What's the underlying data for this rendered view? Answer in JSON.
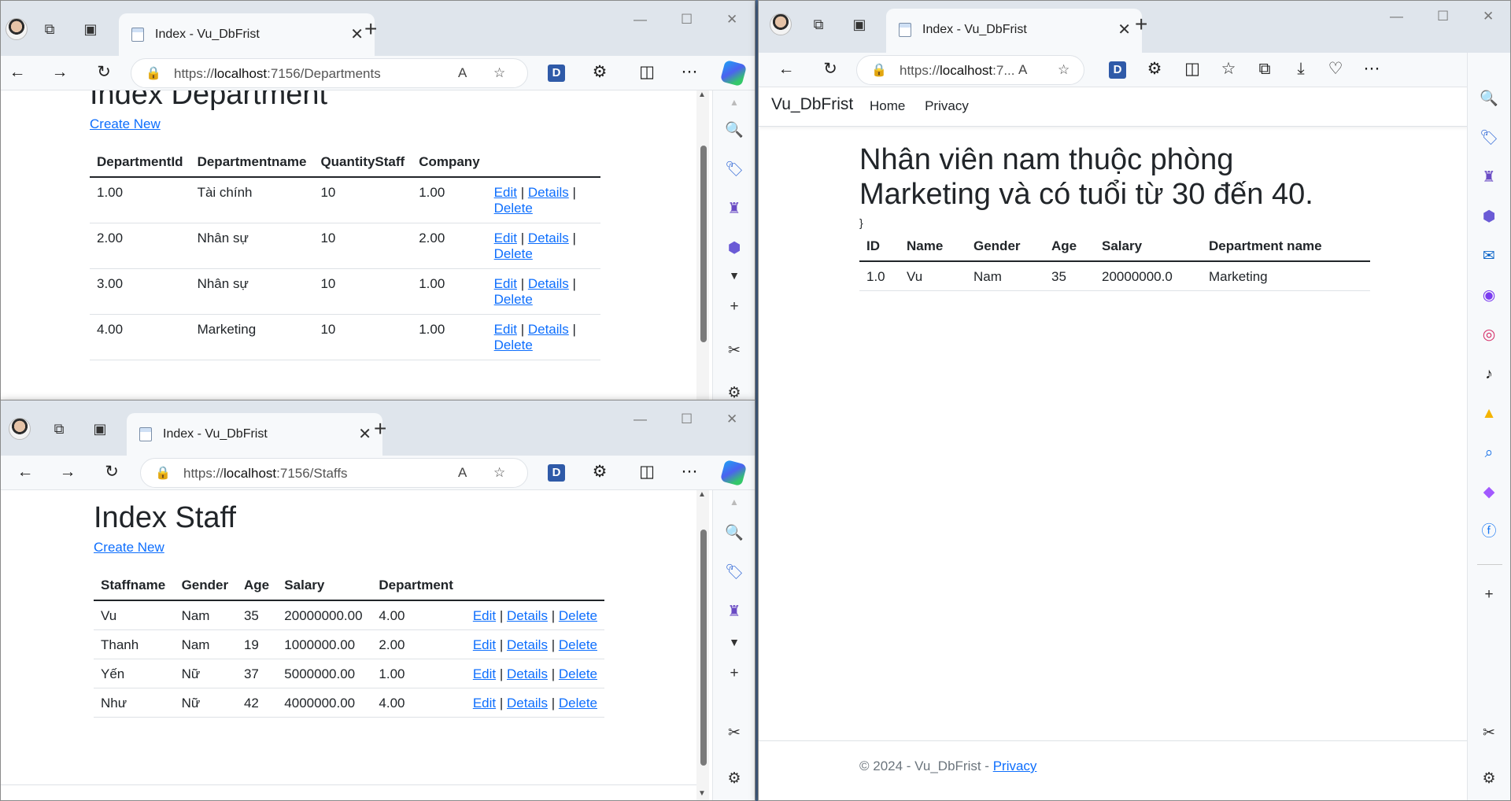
{
  "windows": {
    "departments": {
      "tab_title": "Index - Vu_DbFrist",
      "url_prefix": "https://",
      "url_host": "localhost",
      "url_rest": ":7156/Departments",
      "page": {
        "title": "Index Department",
        "create_new": "Create New",
        "columns": [
          "DepartmentId",
          "Departmentname",
          "QuantityStaff",
          "Company"
        ],
        "rows": [
          {
            "id": "1.00",
            "name": "Tài chính",
            "qty": "10",
            "company": "1.00"
          },
          {
            "id": "2.00",
            "name": "Nhân sự",
            "qty": "10",
            "company": "2.00"
          },
          {
            "id": "3.00",
            "name": "Nhân sự",
            "qty": "10",
            "company": "1.00"
          },
          {
            "id": "4.00",
            "name": "Marketing",
            "qty": "10",
            "company": "1.00"
          }
        ]
      }
    },
    "staffs": {
      "tab_title": "Index - Vu_DbFrist",
      "url_prefix": "https://",
      "url_host": "localhost",
      "url_rest": ":7156/Staffs",
      "page": {
        "title": "Index Staff",
        "create_new": "Create New",
        "columns": [
          "Staffname",
          "Gender",
          "Age",
          "Salary",
          "Department"
        ],
        "rows": [
          {
            "name": "Vu",
            "gender": "Nam",
            "age": "35",
            "salary": "20000000.00",
            "dept": "4.00"
          },
          {
            "name": "Thanh",
            "gender": "Nam",
            "age": "19",
            "salary": "1000000.00",
            "dept": "2.00"
          },
          {
            "name": "Yến",
            "gender": "Nữ",
            "age": "37",
            "salary": "5000000.00",
            "dept": "1.00"
          },
          {
            "name": "Như",
            "gender": "Nữ",
            "age": "42",
            "salary": "4000000.00",
            "dept": "4.00"
          }
        ]
      }
    },
    "query": {
      "tab_title": "Index - Vu_DbFrist",
      "url_prefix": "https://",
      "url_host": "localhost",
      "url_rest": ":7...",
      "brand": "Vu_DbFrist",
      "nav": [
        "Home",
        "Privacy"
      ],
      "page": {
        "title_line1": "Nhân viên nam thuộc phòng",
        "title_line2": "Marketing và có tuổi từ 30 đến 40.",
        "stray_text": "}",
        "columns": [
          "ID",
          "Name",
          "Gender",
          "Age",
          "Salary",
          "Department name"
        ],
        "rows": [
          {
            "id": "1.0",
            "name": "Vu",
            "gender": "Nam",
            "age": "35",
            "salary": "20000000.0",
            "dept": "Marketing"
          }
        ]
      },
      "footer_text": "© 2024 - Vu_DbFrist - ",
      "footer_link": "Privacy"
    }
  },
  "row_actions": {
    "edit": "Edit",
    "details": "Details",
    "delete": "Delete",
    "sep": "|"
  },
  "window_controls": {
    "minimize": "—",
    "maximize": "☐",
    "close": "✕"
  },
  "icons": {
    "workspaces": "workspaces-icon",
    "tab-actions": "tab-actions-icon",
    "back": "back-icon",
    "forward": "forward-icon",
    "refresh": "refresh-icon",
    "lock": "lock-icon",
    "read-aloud": "read-aloud-icon",
    "favorite": "favorite-icon",
    "extensions": "extensions-icon",
    "split": "split-screen-icon",
    "more": "more-icon",
    "copilot": "copilot-icon"
  },
  "colors": {
    "link": "#0d6efd",
    "tab_strip": "#dfe5ec",
    "toolbar": "#f7f9fb",
    "desktop": "#4f6f99"
  }
}
